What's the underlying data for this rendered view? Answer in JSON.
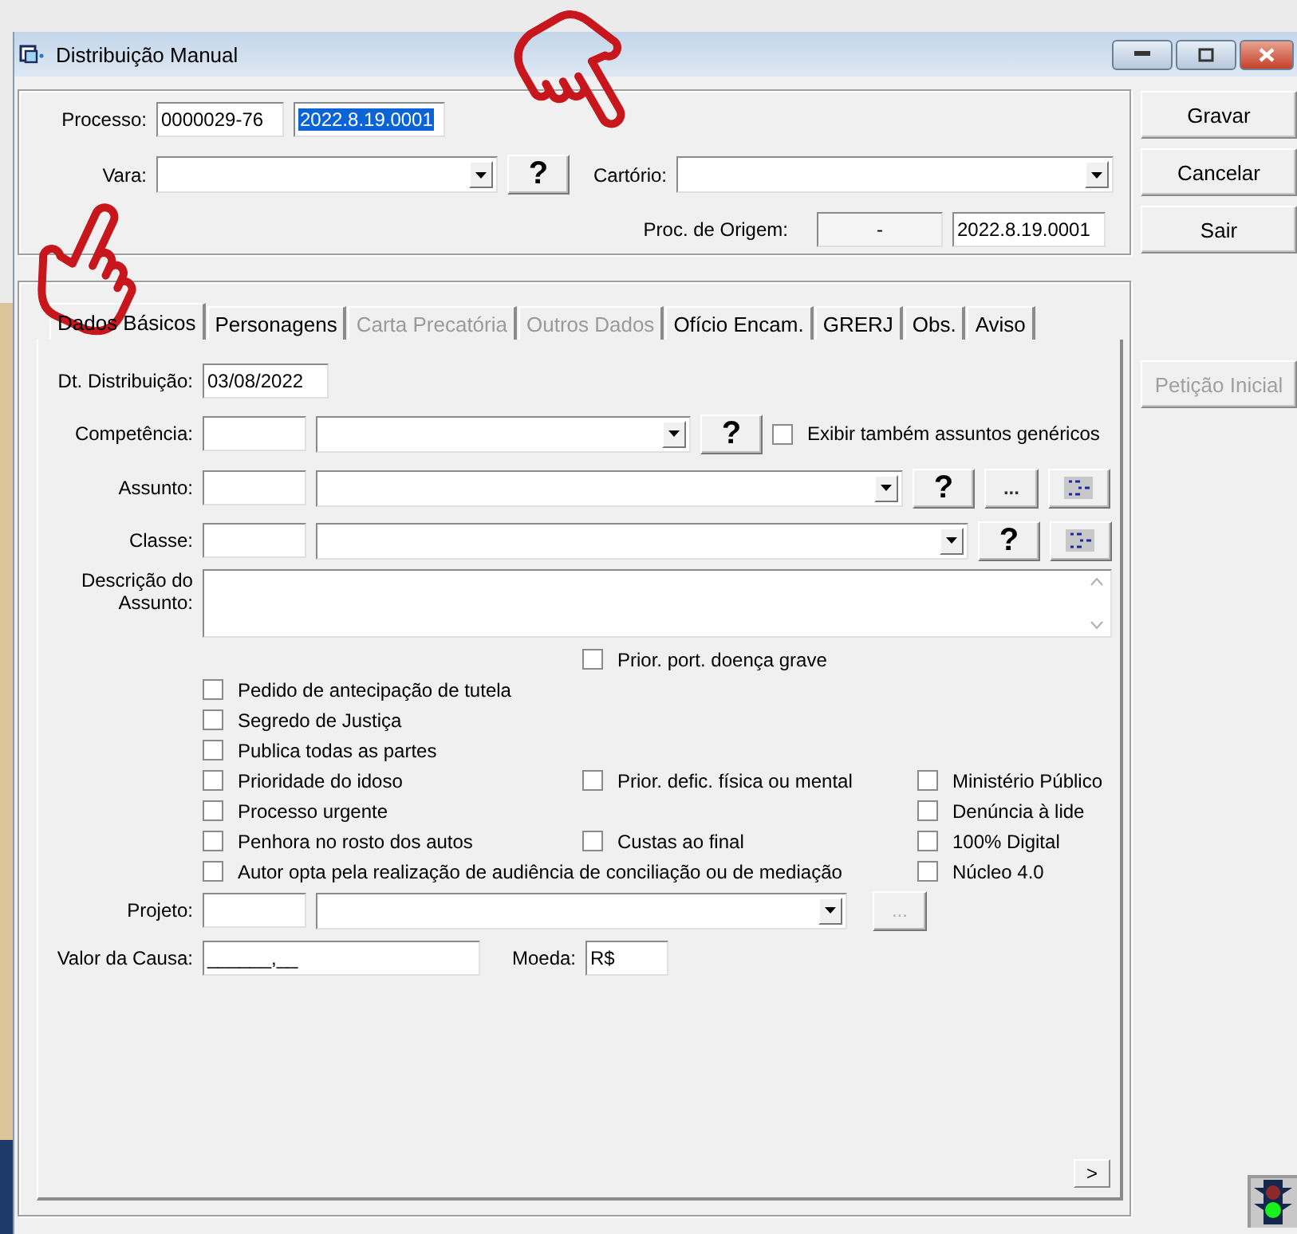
{
  "window": {
    "title": "Distribuição Manual"
  },
  "header": {
    "processo": {
      "label": "Processo:",
      "number": "0000029-76",
      "code": "2022.8.19.0001",
      "code_selected": true
    },
    "vara": {
      "label": "Vara:",
      "help": "?"
    },
    "cartorio": {
      "label": "Cartório:"
    },
    "origem": {
      "label": "Proc. de Origem:",
      "number": "-",
      "code": "2022.8.19.0001"
    }
  },
  "side_buttons": [
    {
      "label": "Gravar",
      "disabled": false
    },
    {
      "label": "Cancelar",
      "disabled": false
    },
    {
      "label": "Sair",
      "disabled": false
    },
    {
      "label": "Petição Inicial",
      "disabled": true
    }
  ],
  "tabs": [
    {
      "label": "Dados Básicos",
      "selected": true,
      "disabled": false
    },
    {
      "label": "Personagens",
      "selected": false,
      "disabled": false
    },
    {
      "label": "Carta Precatória",
      "selected": false,
      "disabled": true
    },
    {
      "label": "Outros Dados",
      "selected": false,
      "disabled": true
    },
    {
      "label": "Ofício Encam.",
      "selected": false,
      "disabled": false
    },
    {
      "label": "GRERJ",
      "selected": false,
      "disabled": false
    },
    {
      "label": "Obs.",
      "selected": false,
      "disabled": false
    },
    {
      "label": "Aviso",
      "selected": false,
      "disabled": false
    }
  ],
  "form": {
    "dt_distribuicao": {
      "label": "Dt. Distribuição:",
      "value": "03/08/2022"
    },
    "competencia": {
      "label": "Competência:",
      "help": "?",
      "option_label": "Exibir também assuntos genéricos",
      "checked": false
    },
    "assunto": {
      "label": "Assunto:",
      "help": "?",
      "more": "..."
    },
    "classe": {
      "label": "Classe:",
      "help": "?"
    },
    "descricao": {
      "label": "Descrição do Assunto:"
    },
    "checkbox_rows": [
      {
        "cells": [
          null,
          {
            "label": "Prior. port. doença grave",
            "checked": false
          },
          null
        ]
      },
      {
        "cells": [
          {
            "label": "Pedido de antecipação de tutela",
            "checked": false
          },
          null,
          null
        ]
      },
      {
        "cells": [
          {
            "label": "Segredo de Justiça",
            "checked": false
          },
          null,
          null
        ]
      },
      {
        "cells": [
          {
            "label": "Publica todas as partes",
            "checked": false
          },
          null,
          null
        ]
      },
      {
        "cells": [
          {
            "label": "Prioridade do idoso",
            "checked": false
          },
          {
            "label": "Prior. defic. física ou mental",
            "checked": false
          },
          {
            "label": "Ministério Público",
            "checked": false
          }
        ]
      },
      {
        "cells": [
          {
            "label": "Processo urgente",
            "checked": false
          },
          null,
          {
            "label": "Denúncia à lide",
            "checked": false
          }
        ]
      },
      {
        "cells": [
          {
            "label": "Penhora no rosto dos autos",
            "checked": false
          },
          {
            "label": "Custas ao final",
            "checked": false
          },
          {
            "label": "100% Digital",
            "checked": false
          }
        ]
      },
      {
        "cells": [
          {
            "label": "Autor opta pela realização de audiência de conciliação ou de mediação",
            "checked": false
          },
          null,
          {
            "label": "Núcleo 4.0",
            "checked": false
          }
        ]
      }
    ],
    "projeto": {
      "label": "Projeto:",
      "more": "...",
      "more_disabled": true
    },
    "valor": {
      "label": "Valor da Causa:",
      "value": "______,__"
    },
    "moeda": {
      "label": "Moeda:",
      "value": "R$"
    },
    "next": ">"
  }
}
